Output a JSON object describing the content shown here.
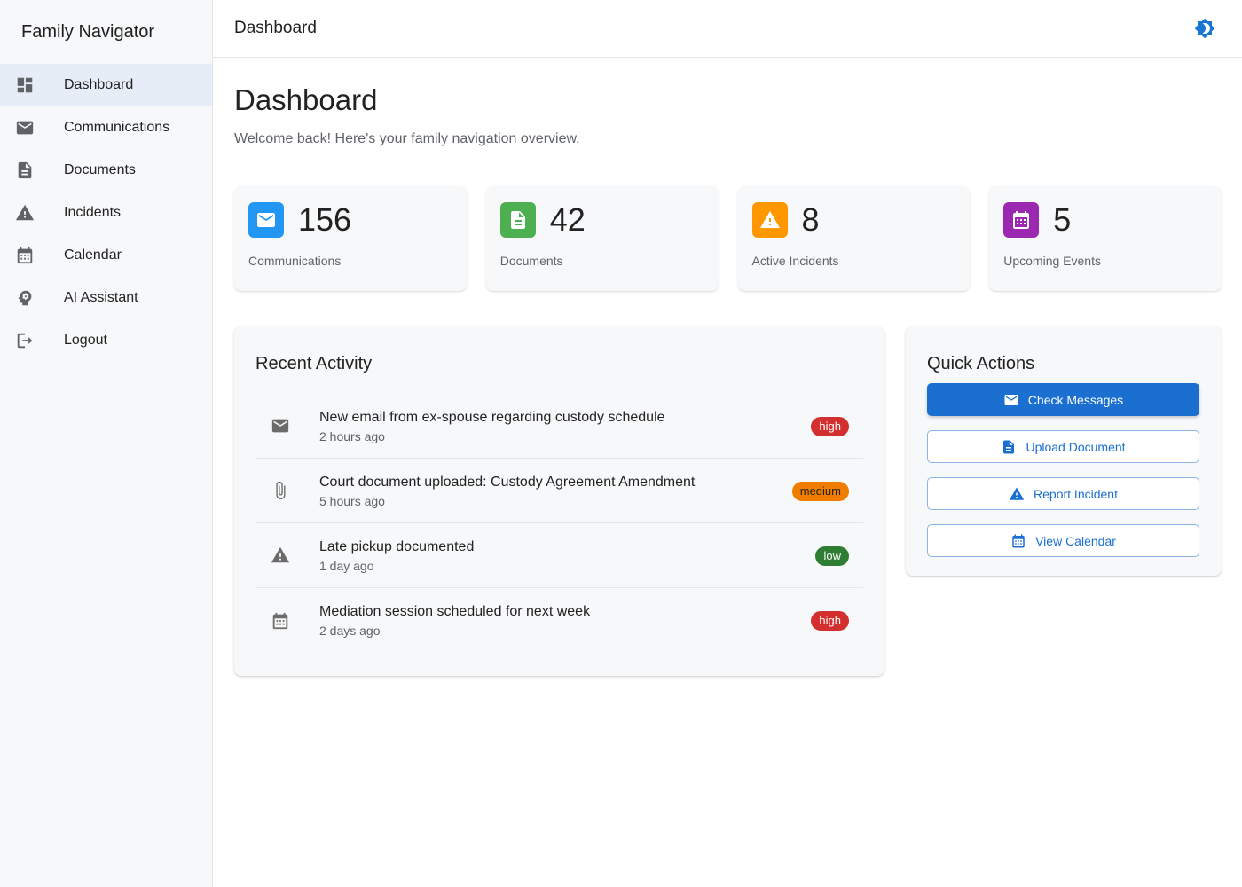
{
  "app": {
    "name": "Family Navigator"
  },
  "sidebar": {
    "items": [
      {
        "label": "Dashboard",
        "icon": "dashboard-icon"
      },
      {
        "label": "Communications",
        "icon": "mail-icon"
      },
      {
        "label": "Documents",
        "icon": "document-icon"
      },
      {
        "label": "Incidents",
        "icon": "warning-icon"
      },
      {
        "label": "Calendar",
        "icon": "calendar-icon"
      },
      {
        "label": "AI Assistant",
        "icon": "psychology-icon"
      },
      {
        "label": "Logout",
        "icon": "logout-icon"
      }
    ]
  },
  "header": {
    "title": "Dashboard",
    "theme_icon": "brightness-icon"
  },
  "main": {
    "title": "Dashboard",
    "subtitle": "Welcome back! Here's your family navigation overview."
  },
  "stats": [
    {
      "value": "156",
      "label": "Communications",
      "icon": "mail-icon",
      "color": "#2196f3"
    },
    {
      "value": "42",
      "label": "Documents",
      "icon": "document-icon",
      "color": "#4caf50"
    },
    {
      "value": "8",
      "label": "Active Incidents",
      "icon": "warning-icon",
      "color": "#ff9800"
    },
    {
      "value": "5",
      "label": "Upcoming Events",
      "icon": "calendar-icon",
      "color": "#9c27b0"
    }
  ],
  "recent_activity": {
    "title": "Recent Activity",
    "items": [
      {
        "title": "New email from ex-spouse regarding custody schedule",
        "time": "2 hours ago",
        "priority": "high",
        "icon": "mail-icon"
      },
      {
        "title": "Court document uploaded: Custody Agreement Amendment",
        "time": "5 hours ago",
        "priority": "medium",
        "icon": "attachment-icon"
      },
      {
        "title": "Late pickup documented",
        "time": "1 day ago",
        "priority": "low",
        "icon": "warning-icon"
      },
      {
        "title": "Mediation session scheduled for next week",
        "time": "2 days ago",
        "priority": "high",
        "icon": "calendar-icon"
      }
    ]
  },
  "quick_actions": {
    "title": "Quick Actions",
    "buttons": [
      {
        "label": "Check Messages",
        "icon": "mail-icon"
      },
      {
        "label": "Upload Document",
        "icon": "document-icon"
      },
      {
        "label": "Report Incident",
        "icon": "warning-icon"
      },
      {
        "label": "View Calendar",
        "icon": "calendar-icon"
      }
    ]
  },
  "colors": {
    "primary": "#1a6fd1",
    "priority_high": "#d32f2f",
    "priority_medium": "#f07c00",
    "priority_low": "#2e7d32"
  }
}
